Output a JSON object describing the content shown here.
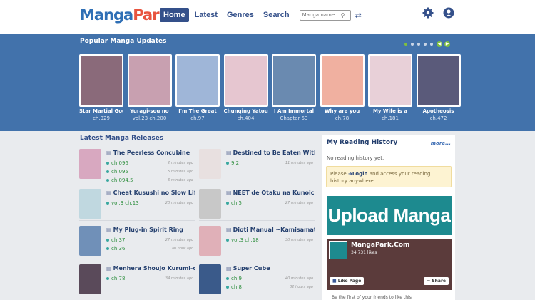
{
  "header": {
    "logo_part1": "Manga",
    "logo_part2": "Park",
    "nav": [
      "Home",
      "Latest",
      "Genres",
      "Search"
    ],
    "search_placeholder": "Manga name"
  },
  "colors": {
    "brand": "#34508a",
    "popular_bg": "#4272ab",
    "accent_green": "#7fbf3f",
    "upload_bg": "#1d8a8f"
  },
  "popular": {
    "title": "Popular Manga Updates",
    "items": [
      {
        "title": "Star Martial God",
        "chapter": "ch.329",
        "color": "#8a6a7a"
      },
      {
        "title": "Yuragi-sou no",
        "chapter": "vol.23 ch.200",
        "color": "#c8a0b0"
      },
      {
        "title": "I'm The Great",
        "chapter": "ch.97",
        "color": "#9fb6d8"
      },
      {
        "title": "Chunqing Yatou",
        "chapter": "ch.404",
        "color": "#e6c6d0"
      },
      {
        "title": "I Am Immortal",
        "chapter": "Chapter 53",
        "color": "#6a8ab0"
      },
      {
        "title": "Why are you",
        "chapter": "ch.78",
        "color": "#f0b0a0"
      },
      {
        "title": "My Wife is a",
        "chapter": "ch.181",
        "color": "#e8d0d8"
      },
      {
        "title": "Apotheosis",
        "chapter": "ch.472",
        "color": "#5a5a7a"
      }
    ]
  },
  "releases": {
    "title": "Latest Manga Releases",
    "items": [
      {
        "title": "The Peerless Concubine",
        "color": "#d8a8c0",
        "chapters": [
          {
            "ch": "ch.096",
            "time": "2 minutes ago"
          },
          {
            "ch": "ch.095",
            "time": "5 minutes ago"
          },
          {
            "ch": "ch.094.5",
            "time": "6 minutes ago"
          }
        ]
      },
      {
        "title": "Destined to Be Eaten Withi",
        "color": "#e8e0e0",
        "chapters": [
          {
            "ch": "9.2",
            "time": "11 minutes ago"
          }
        ]
      },
      {
        "title": "Cheat Kusushi no Slow Life",
        "color": "#c0d8e0",
        "chapters": [
          {
            "ch": "vol.3 ch.13",
            "time": "20 minutes ago"
          }
        ]
      },
      {
        "title": "NEET de Otaku na Kunoichi",
        "color": "#c8c8c8",
        "chapters": [
          {
            "ch": "ch.5",
            "time": "27 minutes ago"
          }
        ]
      },
      {
        "title": "My Plug-in Spirit Ring",
        "color": "#7090b8",
        "chapters": [
          {
            "ch": "ch.37",
            "time": "27 minutes ago"
          },
          {
            "ch": "ch.36",
            "time": "an hour ago"
          }
        ]
      },
      {
        "title": "Dioti Manual ~Kamisamata",
        "color": "#e0b0b8",
        "chapters": [
          {
            "ch": "vol.3 ch.18",
            "time": "30 minutes ago"
          }
        ]
      },
      {
        "title": "Menhera Shoujo Kurumi-ch",
        "color": "#5a4a5a",
        "chapters": [
          {
            "ch": "ch.78",
            "time": "34 minutes ago"
          }
        ]
      },
      {
        "title": "Super Cube",
        "color": "#3a5a8a",
        "chapters": [
          {
            "ch": "ch.9",
            "time": "40 minutes ago"
          },
          {
            "ch": "ch.8",
            "time": "32 hours ago"
          }
        ]
      }
    ]
  },
  "history": {
    "title": "My Reading History",
    "more": "more...",
    "empty": "No reading history yet.",
    "login_prefix": "Please ",
    "login_link": "Login",
    "login_suffix": " and access your reading history anywhere."
  },
  "upload": {
    "label": "Upload Manga"
  },
  "facebook": {
    "name": "MangaPark.Com",
    "likes": "34,731 likes",
    "like_btn": "Like Page",
    "share_btn": "Share",
    "footer": "Be the first of your friends to like this"
  }
}
